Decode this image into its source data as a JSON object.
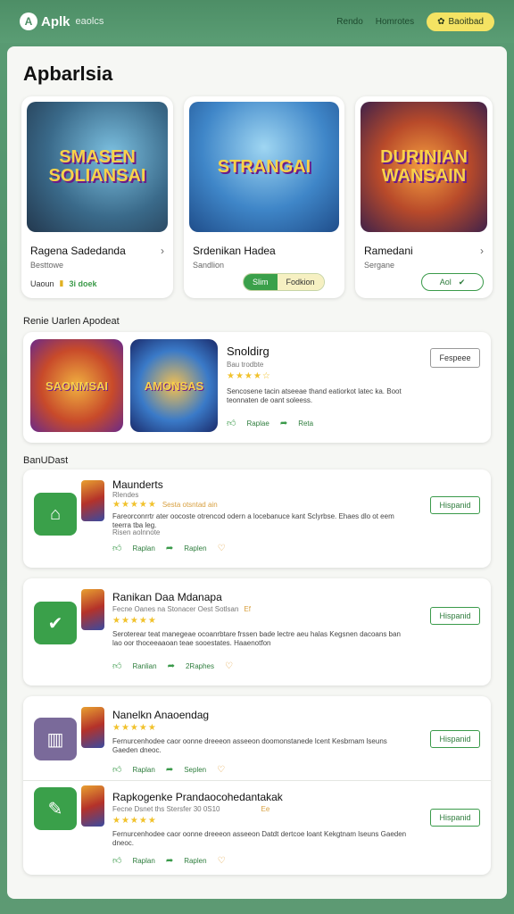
{
  "header": {
    "logo_mark": "A",
    "logo_text": "Aplk",
    "logo_sub": "eaolcs",
    "nav": [
      "Rendo",
      "Homrotes"
    ],
    "cta": "Baoitbad"
  },
  "page_title": "Apbarlsia",
  "featured": [
    {
      "art": "SMASEN SOLIANSAI",
      "name": "Ragena Sadedanda",
      "sub": "Besttowe",
      "meta_left": "Uaoun",
      "meta_right": "3i doek"
    },
    {
      "art": "STRANGAI",
      "name": "Srdenikan Hadea",
      "sub": "Sandlion",
      "toggle_on": "Slim",
      "toggle_off": "Fodkion"
    },
    {
      "art": "DURINIAN WANSAIN",
      "name": "Ramedani",
      "sub": "Sergane",
      "pill": "Aol"
    }
  ],
  "trending": {
    "label": "Renie Uarlen Apodeat",
    "art_left": "SAONMSAI",
    "art_right": "AMONSAS",
    "title": "Snoldirg",
    "sub": "Bau trodbte",
    "stars": "★★★★☆",
    "desc": "Sencosene tacin atseeae thand eatiorkot latec ka. Boot teonnaten de oant soleess.",
    "action1": "Raplae",
    "action2": "Reta",
    "button": "Fespeee"
  },
  "list_label": "BanUDast",
  "list": [
    {
      "title": "Maunderts",
      "sub": "Rlendes",
      "stars": "★★★★★",
      "meta": "Sesta otsntad ain",
      "desc": "Fareorconrrtr ater oocoste otrencod odern a locebanuce kant Sclyrbse. Ehaes dlo ot eem teerra tba leg.",
      "extra": "Risen aolnnote",
      "a1": "Raplan",
      "a2": "Raplen",
      "btn": "Hispanid"
    },
    {
      "title": "Ranikan Daa Mdanapa",
      "sub": "Fecne Oanes na Stonacer Oest Sotlsan",
      "meta": "Ef",
      "stars": "★★★★★",
      "desc": "Seroterear teat manegeae ocoanrbtare frssen bade lectre aeu halas Kegsnen dacoans ban lao oor thoceeaaoan teae sooestates. Haaenotfon",
      "a1": "Ranlian",
      "a2": "2Raphes",
      "btn": "Hispanid"
    },
    {
      "title": "Nanelkn Anaoendag",
      "stars": "★★★★★",
      "desc": "Fernurcenhodee caor oonne dreeeon asseeon doomonstanede lcent Kesbrnam lseuns Gaeden dneoc.",
      "a1": "Raplan",
      "a2": "Seplen",
      "btn": "Hispanid"
    },
    {
      "title": "Rapkogenke Prandaocohedantakak",
      "sub": "Fecne Dsnet ths Stersfer 30 0S10",
      "meta": "Ee",
      "stars": "★★★★★",
      "desc": "Fernurcenhodee caor oonne dreeeon asseeon Datdt dertcoe loant Kekgtnam lseuns Gaeden dneoc.",
      "a1": "Raplan",
      "a2": "Raplen",
      "btn": "Hispanid"
    }
  ],
  "colors": {
    "accent": "#3aa04a",
    "header": "#4d8e66",
    "yellow": "#f4e363"
  }
}
